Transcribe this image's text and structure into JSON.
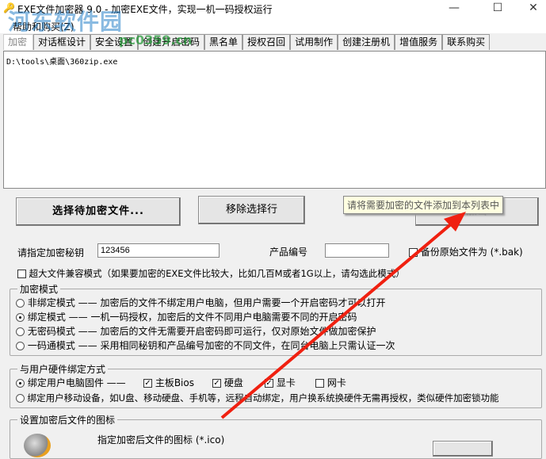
{
  "window": {
    "title": "EXE文件加密器 9.0 - 加密EXE文件，实现一机一码授权运行",
    "minimize": "—",
    "maximize": "☐",
    "close": "✕"
  },
  "menu": {
    "help": "帮助和购买(Z)"
  },
  "watermark": {
    "text": "河东软件园",
    "url": "pc0359.cn"
  },
  "tabs": [
    "加密",
    "对话框设计",
    "安全设置",
    "创建开启密码",
    "黑名单",
    "授权召回",
    "试用制作",
    "创建注册机",
    "增值服务",
    "联系购买"
  ],
  "file_list": [
    "D:\\tools\\桌面\\360zip.exe"
  ],
  "buttons": {
    "select_file": "选择待加密文件...",
    "remove": "移除选择行",
    "encrypt": "加密"
  },
  "tooltip": "请将需要加密的文件添加到本列表中",
  "key": {
    "label": "请指定加密秘钥",
    "value": "123456"
  },
  "product": {
    "label": "产品编号",
    "value": ""
  },
  "backup": {
    "label": "备份原始文件为 (*.bak)",
    "checked": false
  },
  "large_file": {
    "label": "超大文件兼容模式（如果要加密的EXE文件比较大，比如几百M或者1G以上，请勾选此模式）",
    "checked": false
  },
  "mode": {
    "title": "加密模式",
    "options": [
      {
        "label": "非绑定模式 —— 加密后的文件不绑定用户电脑，但用户需要一个开启密码才可以打开",
        "selected": false
      },
      {
        "label": "绑定模式 —— 一机一码授权，加密后的文件不同用户电脑需要不同的开启密码",
        "selected": true
      },
      {
        "label": "无密码模式 —— 加密后的文件无需要开启密码即可运行，仅对原始文件做加密保护",
        "selected": false
      },
      {
        "label": "一码通模式 —— 采用相同秘钥和产品编号加密的不同文件，在同台电脑上只需认证一次",
        "selected": false
      }
    ]
  },
  "hardware": {
    "title": "与用户硬件绑定方式",
    "firmware": "绑定用户电脑固件 ——",
    "bios": "主板Bios",
    "disk": "硬盘",
    "gpu": "显卡",
    "nic": "网卡",
    "mobile": "绑定用户移动设备，如U盘、移动硬盘、手机等，远程自动绑定，用户换系统换硬件无需再授权，类似硬件加密锁功能"
  },
  "icon_group": {
    "title": "设置加密后文件的图标",
    "label": "指定加密后文件的图标 (*.ico)"
  },
  "colors": {
    "arrow": "#f02010"
  }
}
